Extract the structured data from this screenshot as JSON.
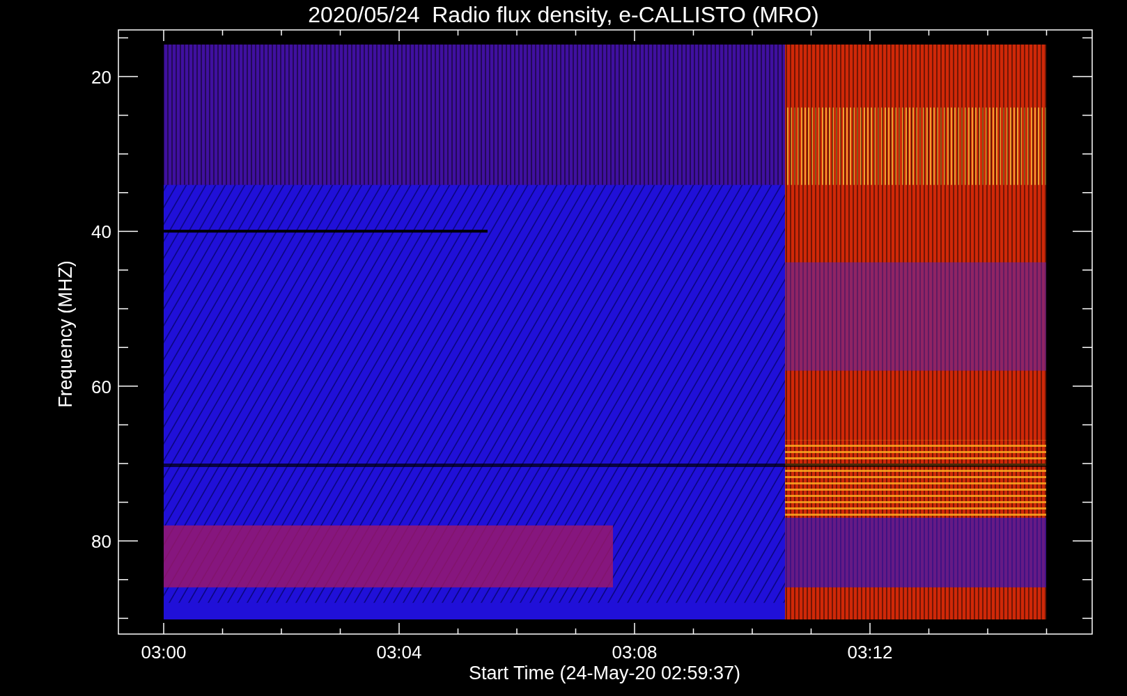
{
  "title": "2020/05/24  Radio flux density, e-CALLISTO (MRO)",
  "y_axis": {
    "label": "Frequency (MHZ)",
    "ticks": [
      "20",
      "40",
      "60",
      "80"
    ]
  },
  "x_axis": {
    "label": "Start Time (24-May-20 02:59:37)",
    "ticks": [
      "03:00",
      "03:04",
      "03:08",
      "03:12"
    ]
  }
}
